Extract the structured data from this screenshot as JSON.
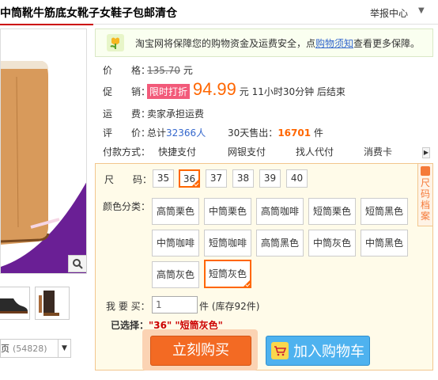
{
  "header": {
    "title": "中筒靴牛筋底女靴子女鞋子包邮清仓",
    "report_link": "举报中心",
    "report_caret": "▼"
  },
  "banner": {
    "text_before": "淘宝网将保障您的购物资金及运费安全，点",
    "link": "购物须知",
    "text_after": "查看更多保障。"
  },
  "price": {
    "label": "价　　格：",
    "original": "135.70",
    "unit": "元"
  },
  "promo": {
    "label": "促　　销：",
    "tag": "限时打折",
    "price": "94.99",
    "unit": "元",
    "countdown": "11小时30分钟 后结束"
  },
  "shipping": {
    "label": "运　　费：",
    "value": "卖家承担运费"
  },
  "reviews": {
    "label": "评　　价：",
    "total_prefix": "总计",
    "total_count": "32366人",
    "sold_prefix": "30天售出：",
    "sold_count": "16701",
    "sold_unit": "件"
  },
  "payment": {
    "label": "付款方式：",
    "options": [
      "快捷支付",
      "网银支付",
      "找人代付",
      "消费卡"
    ],
    "scroll_arrow": "▶"
  },
  "side_tab": {
    "text": "尺码档案"
  },
  "size": {
    "label": "尺　　码：",
    "options": [
      "35",
      "36",
      "37",
      "38",
      "39",
      "40"
    ],
    "selected_index": 1
  },
  "color": {
    "label": "颜色分类：",
    "options": [
      "高筒栗色",
      "中筒栗色",
      "高筒咖啡",
      "短筒栗色",
      "短筒黑色",
      "中筒咖啡",
      "短筒咖啡",
      "高筒黑色",
      "中筒灰色",
      "中筒黑色",
      "高筒灰色",
      "短筒灰色"
    ],
    "selected_index": 11
  },
  "quantity": {
    "label": "我 要 买：",
    "value": "1",
    "stock": "件 (库存92件)"
  },
  "chosen": {
    "label": "已选择：",
    "value": "\"36\" \"短筒灰色\""
  },
  "actions": {
    "buy_now": "立刻购买",
    "add_cart": "加入购物车"
  },
  "gallery": {
    "bottom_label": "页",
    "bottom_count": "(54828)",
    "dropdown_arrow": "▼"
  },
  "colors": {
    "accent": "#ff6600",
    "buy_button": "#f36a23",
    "cart_button": "#4eb2ef",
    "promo_tag": "#f25a7a",
    "link": "#3366cc"
  }
}
